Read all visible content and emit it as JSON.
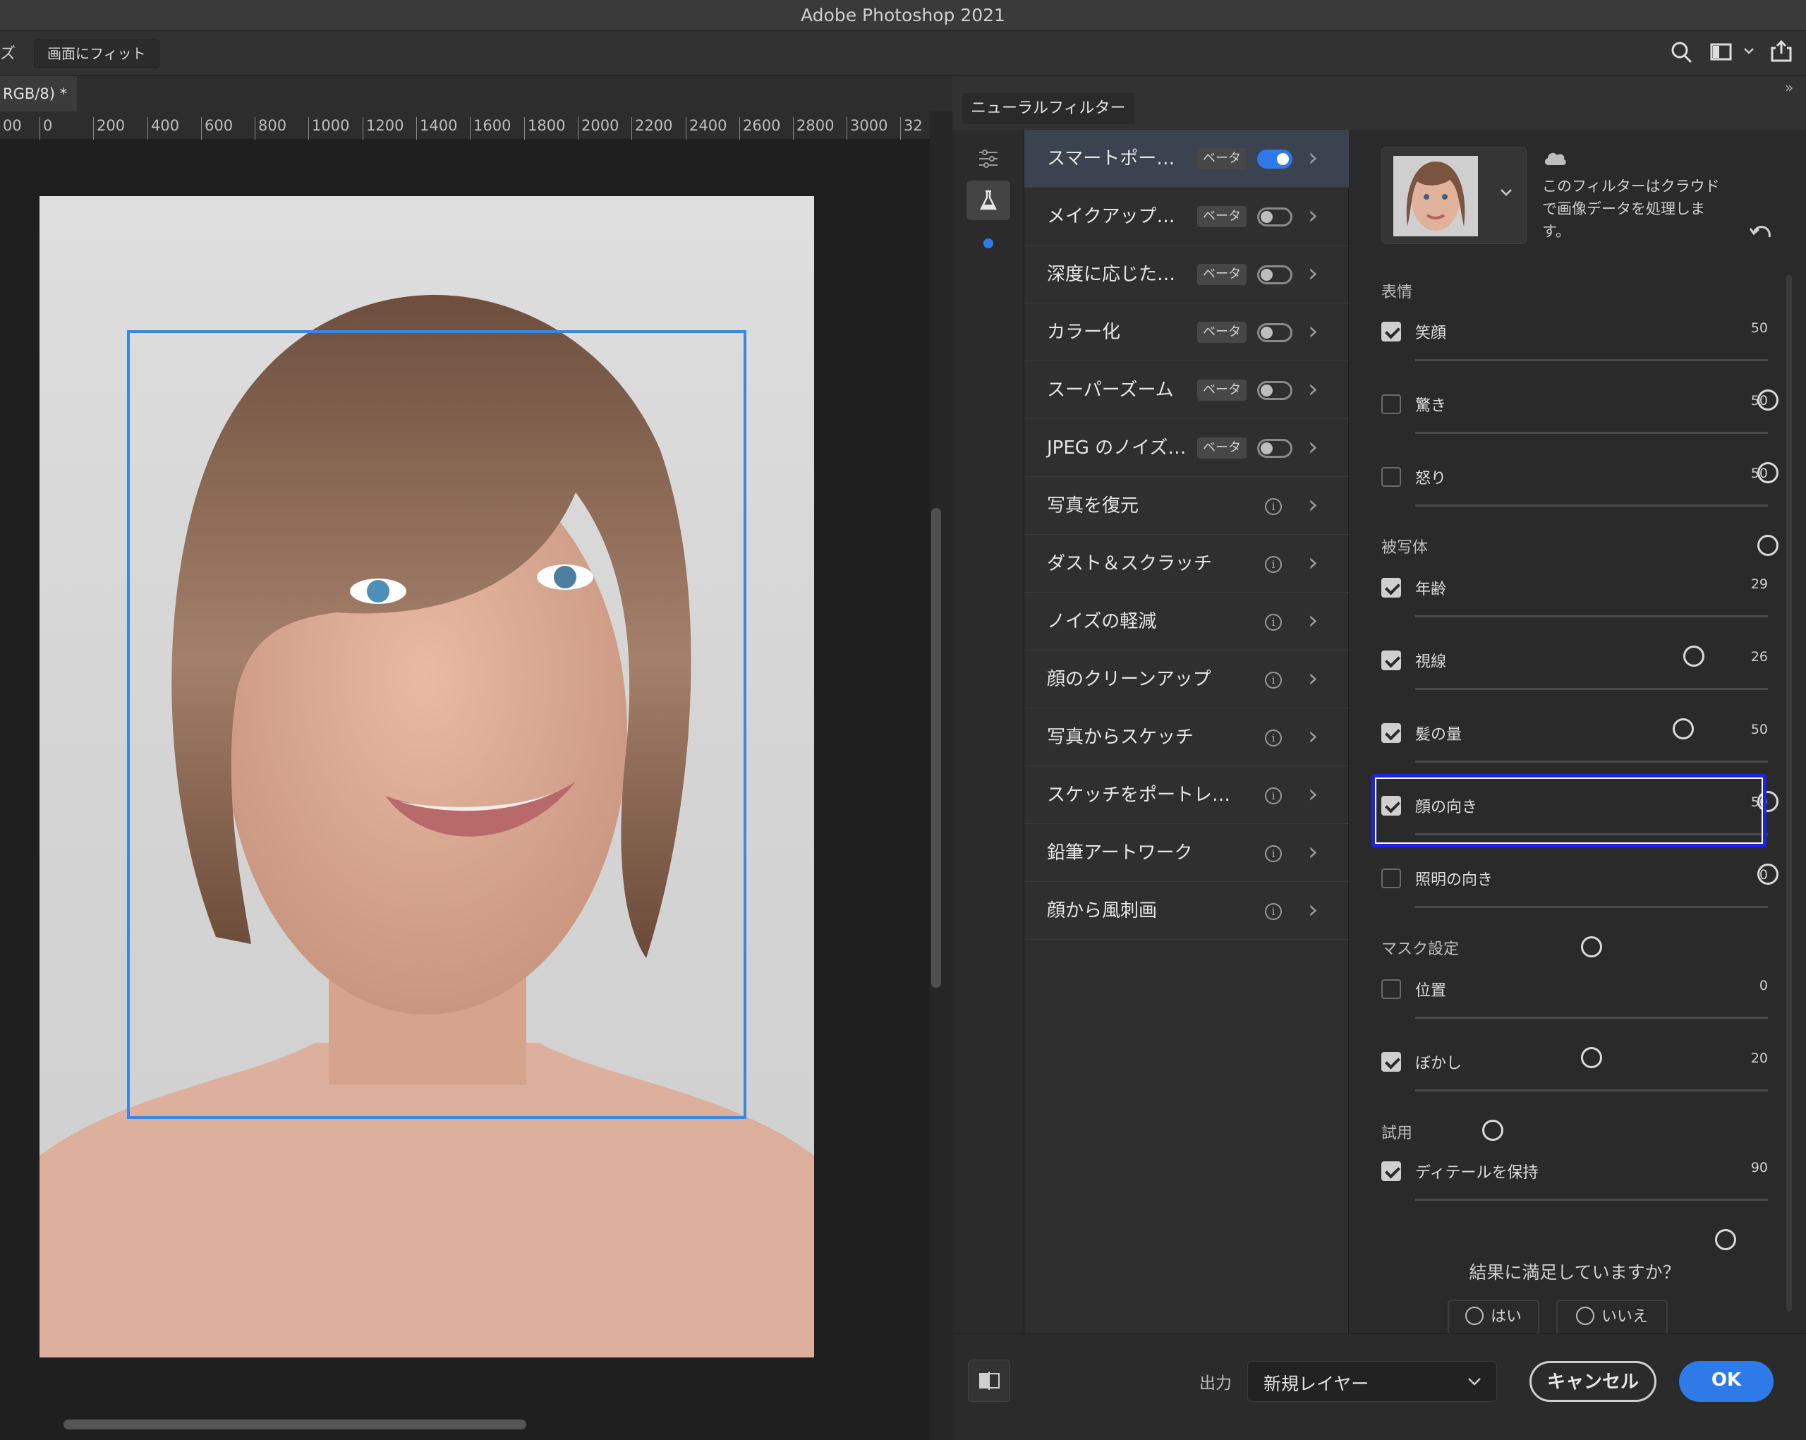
{
  "app": {
    "title": "Adobe Photoshop 2021"
  },
  "options_bar": {
    "left_fragment": "ズ",
    "fit_button": "画面にフィット"
  },
  "document": {
    "tab_label": "RGB/8) *"
  },
  "ruler": {
    "ticks": [
      "00",
      "0",
      "200",
      "400",
      "600",
      "800",
      "1000",
      "1200",
      "1400",
      "1600",
      "1800",
      "2000",
      "2200",
      "2400",
      "2600",
      "2800",
      "3000",
      "32"
    ]
  },
  "panel": {
    "tab_title": "ニューラルフィルター",
    "cloud_notice": "このフィルターはクラウドで画像データを処理します。",
    "filters": [
      {
        "name": "スマートポー…",
        "badge": "ベータ",
        "toggle": true
      },
      {
        "name": "メイクアップ…",
        "badge": "ベータ",
        "toggle": false
      },
      {
        "name": "深度に応じた…",
        "badge": "ベータ",
        "toggle": false
      },
      {
        "name": "カラー化",
        "badge": "ベータ",
        "toggle": false
      },
      {
        "name": "スーパーズーム",
        "badge": "ベータ",
        "toggle": false
      },
      {
        "name": "JPEG のノイズ…",
        "badge": "ベータ",
        "toggle": false
      },
      {
        "name": "写真を復元",
        "info": "i"
      },
      {
        "name": "ダスト＆スクラッチ",
        "info": "i"
      },
      {
        "name": "ノイズの軽減",
        "info": "i"
      },
      {
        "name": "顔のクリーンアップ",
        "info": "i"
      },
      {
        "name": "写真からスケッチ",
        "info": "i"
      },
      {
        "name": "スケッチをポートレ…",
        "info": "i"
      },
      {
        "name": "鉛筆アートワーク",
        "info": "i"
      },
      {
        "name": "顔から風刺画",
        "info": "i"
      }
    ],
    "sections": {
      "expression": "表情",
      "subject": "被写体",
      "mask": "マスク設定",
      "trial": "試用"
    },
    "sliders": [
      {
        "label": "笑顔",
        "value": "50",
        "checked": true,
        "pos": 1.0
      },
      {
        "label": "驚き",
        "value": "50",
        "checked": false,
        "pos": 1.0
      },
      {
        "label": "怒り",
        "value": "50",
        "checked": false,
        "pos": 1.0
      },
      {
        "label": "年齢",
        "value": "29",
        "checked": true,
        "pos": 0.79
      },
      {
        "label": "視線",
        "value": "26",
        "checked": true,
        "pos": 0.76
      },
      {
        "label": "髪の量",
        "value": "50",
        "checked": true,
        "pos": 1.0
      },
      {
        "label": "顔の向き",
        "value": "50",
        "checked": true,
        "pos": 1.0
      },
      {
        "label": "照明の向き",
        "value": "0",
        "checked": false,
        "pos": 0.5
      },
      {
        "label": "位置",
        "value": "0",
        "checked": false,
        "pos": 0.5
      },
      {
        "label": "ぼかし",
        "value": "20",
        "checked": true,
        "pos": 0.22
      },
      {
        "label": "ディテールを保持",
        "value": "90",
        "checked": true,
        "pos": 0.88
      }
    ],
    "feedback": {
      "question": "結果に満足していますか？",
      "yes": "はい",
      "no": "いいえ"
    },
    "output": {
      "label": "出力",
      "value": "新規レイヤー"
    },
    "cancel": "キャンセル",
    "ok": "OK"
  }
}
